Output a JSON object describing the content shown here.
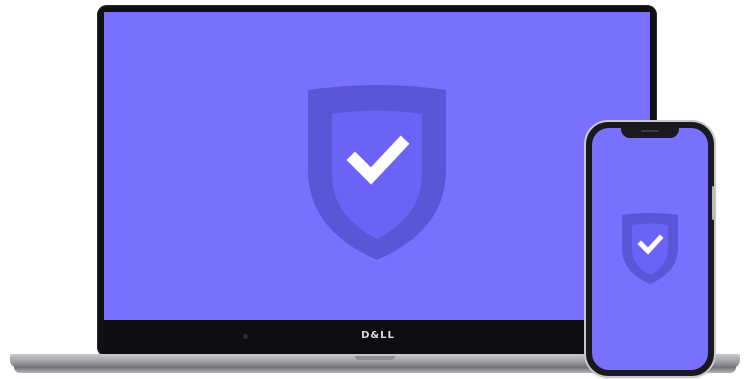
{
  "laptop": {
    "brand_label": "D&LL",
    "screen_icon": "shield-check-icon"
  },
  "phone": {
    "screen_icon": "shield-check-icon"
  },
  "colors": {
    "screen_background": "#7a70ff",
    "shield_outer": "#5b56d6",
    "shield_inner": "#6a63f5",
    "check": "#ffffff",
    "device_frame": "#111114",
    "laptop_base": "#a8a9ad"
  }
}
